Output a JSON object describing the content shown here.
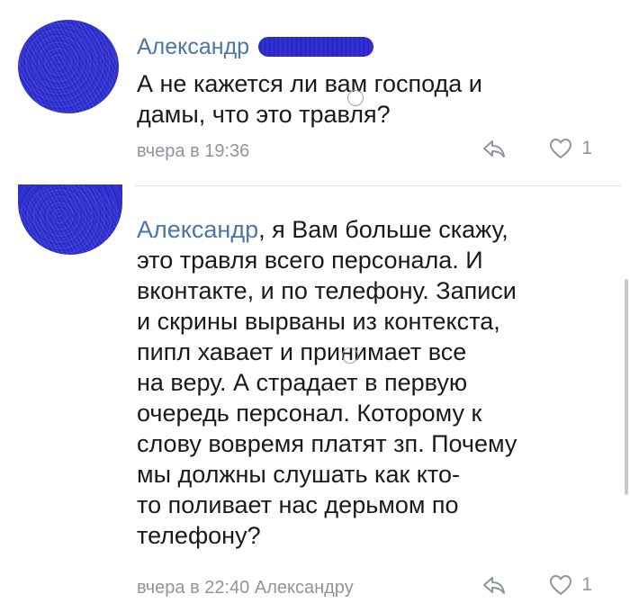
{
  "comments": [
    {
      "author": "Александр",
      "text": "А не кажется ли вам господа и\nдамы, что это травля?",
      "timestamp": "вчера в 19:36",
      "likes": "1",
      "icons": {
        "reply": "reply-icon",
        "like": "heart-icon"
      }
    },
    {
      "reply_to": "Александр",
      "text": ", я Вам больше скажу,\nэто травля всего персонала. И\nвконтакте, и по телефону. Записи\nи скрины вырваны из контекста,\nпипл хавает и принимает все\nна веру. А страдает в первую\nочередь персонал. Которому к\nслову вовремя платят зп. Почему\nмы должны слушать как кто-\nто поливает нас дерьмом по\nтелефону?",
      "timestamp": "вчера в 22:40 Александру",
      "likes": "1",
      "icons": {
        "reply": "reply-icon",
        "like": "heart-icon"
      }
    }
  ],
  "colors": {
    "link": "#4a76a8",
    "meta": "#8f959e",
    "text": "#1a1a1a",
    "redaction": "#2b2bcf"
  }
}
